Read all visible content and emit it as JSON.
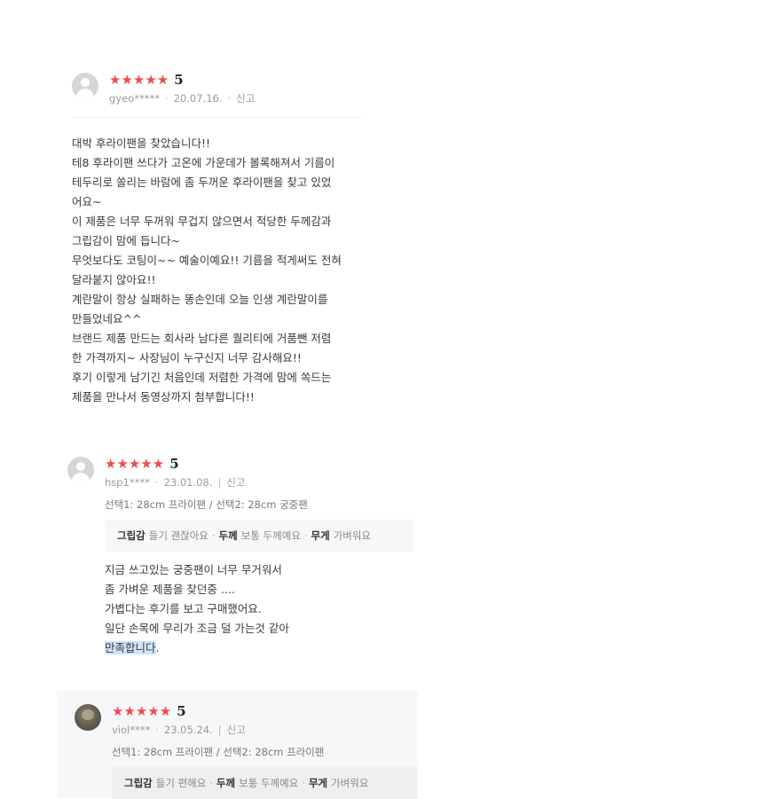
{
  "reviews": [
    {
      "stars": "★★★★★",
      "score": "5",
      "user": "gyeo*****",
      "date": "20.07.16.",
      "report": "신고",
      "lines": [
        "대박 후라이팬을 찾았습니다!!",
        "테8 후라이팬 쓰다가 고온에 가운데가 볼록해져서 기름이",
        "테두리로 쏠리는 바람에 좀 두꺼운 후라이팬을 찾고 있었",
        "어요~",
        "이 제품은 너무 두꺼워 무겁지 않으면서 적당한 두께감과",
        "그립감이 맘에 듭니다~",
        "무엇보다도 코팅이~~ 예술이예요!! 기름을 적게써도 전혀",
        "달라붙지 않아요!!",
        "계란말이 항상 실패하는 똥손인데 오늘 인생 계란말이를",
        "만들었네요^^",
        "브랜드 제품 만드는 회사라 남다른 퀄리티에 거품뺀 저렴",
        "한 가격까지~ 사장님이 누구신지 너무 감사해요!!",
        "후기 이렇게 남기긴 처음인데 저렴한 가격에 맘에 쏙드는",
        "제품을 만나서 동영상까지 첨부합니다!!"
      ]
    },
    {
      "stars": "★★★★★",
      "score": "5",
      "user": "hsp1****",
      "date": "23.01.08.",
      "report": "신고",
      "option": "선택1: 28cm 프라이팬 / 선택2: 28cm 궁중팬",
      "attrs": [
        {
          "name": "그립감",
          "value": "들기 괜찮아요"
        },
        {
          "name": "두께",
          "value": "보통 두께예요"
        },
        {
          "name": "무게",
          "value": "가벼워요"
        }
      ],
      "lines": [
        "지금 쓰고있는 궁중팬이 너무 무거워서",
        "좀 가벼운 제품을 찾던중 ....",
        "가볍다는 후기를 보고 구매했어요.",
        "일단 손목에 무리가 조금 덜 가는것 같아"
      ],
      "last_line_highlight": "만족합니다",
      "last_line_rest": "."
    },
    {
      "stars": "★★★★★",
      "score": "5",
      "user": "viol****",
      "date": "23.05.24.",
      "report": "신고",
      "option": "선택1: 28cm 프라이팬 / 선택2: 28cm 프라이팬",
      "attrs": [
        {
          "name": "그립감",
          "value": "들기 편해요"
        },
        {
          "name": "두께",
          "value": "보통 두께예요"
        },
        {
          "name": "무게",
          "value": "가벼워요"
        }
      ]
    }
  ]
}
